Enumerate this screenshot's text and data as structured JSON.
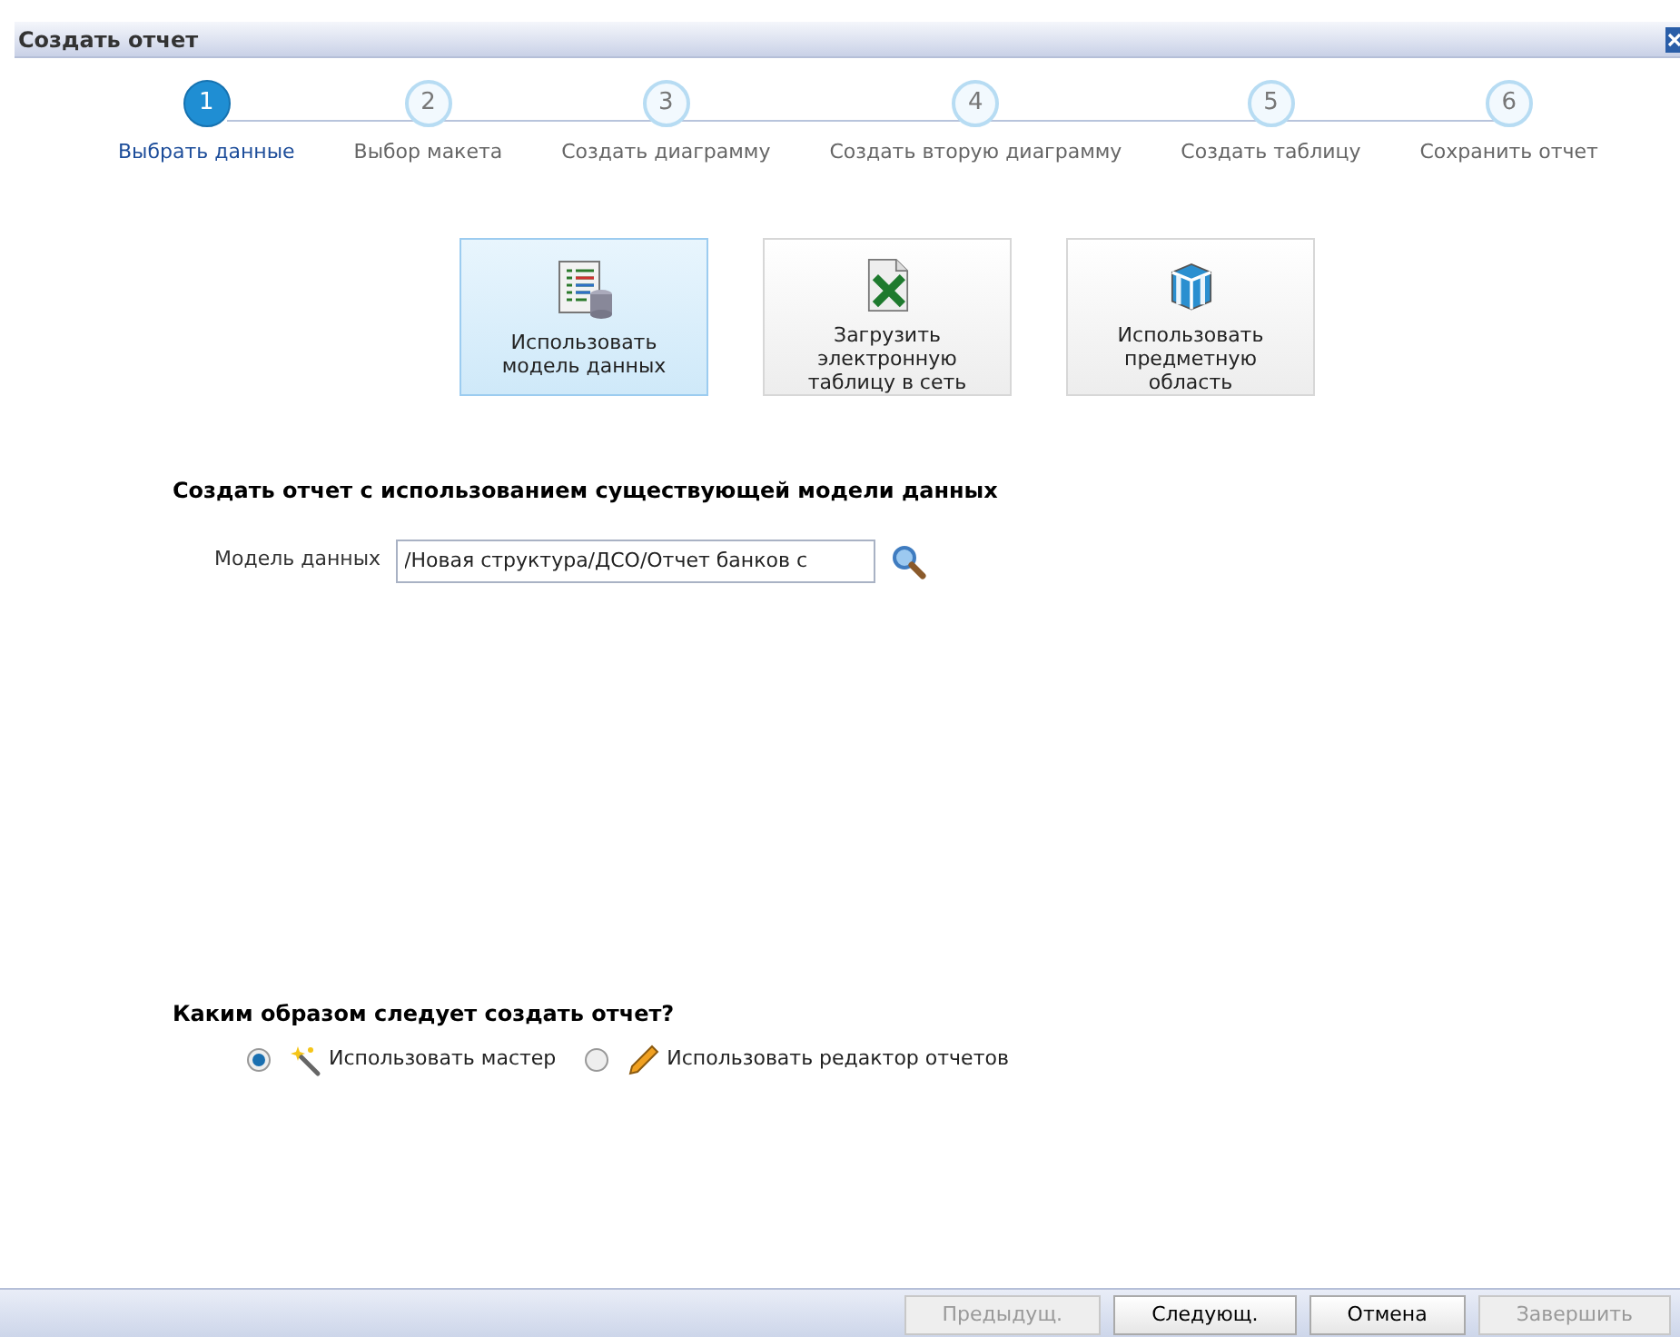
{
  "window": {
    "title": "Создать отчет"
  },
  "steps": [
    {
      "number": "1",
      "label": "Выбрать данные",
      "selected": true
    },
    {
      "number": "2",
      "label": "Выбор макета",
      "selected": false
    },
    {
      "number": "3",
      "label": "Создать диаграмму",
      "selected": false
    },
    {
      "number": "4",
      "label": "Создать вторую диаграмму",
      "selected": false
    },
    {
      "number": "5",
      "label": "Создать таблицу",
      "selected": false
    },
    {
      "number": "6",
      "label": "Сохранить отчет",
      "selected": false
    }
  ],
  "sources": [
    {
      "kind": "model",
      "lines": [
        "Использовать",
        "модель данных"
      ],
      "selected": true
    },
    {
      "kind": "spreadsheet",
      "lines": [
        "Загрузить",
        "электронную",
        "таблицу в сеть"
      ],
      "selected": false
    },
    {
      "kind": "subject",
      "lines": [
        "Использовать",
        "предметную",
        "область"
      ],
      "selected": false
    }
  ],
  "section_title": "Создать отчет с использованием существующей модели данных",
  "data_model": {
    "label": "Модель данных",
    "value": "/Новая структура/ДСО/Отчет банков с"
  },
  "question": "Каким образом следует создать отчет?",
  "options": [
    {
      "kind": "wizard",
      "label": "Использовать мастер",
      "selected": true
    },
    {
      "kind": "editor",
      "label": "Использовать редактор отчетов",
      "selected": false
    }
  ],
  "buttons": [
    {
      "label": "Предыдущ.",
      "disabled": true
    },
    {
      "label": "Следующ.",
      "disabled": false
    },
    {
      "label": "Отмена",
      "disabled": false
    },
    {
      "label": "Завершить",
      "disabled": true
    }
  ]
}
